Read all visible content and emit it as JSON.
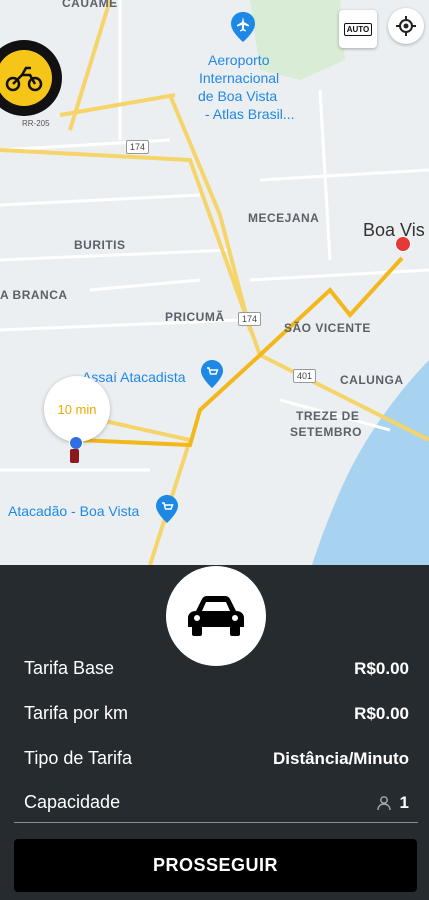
{
  "map": {
    "labels": {
      "cauame": "CAUAME",
      "airport_line1": "Aeroporto",
      "airport_line2": "Internacional",
      "airport_line3": "de Boa Vista",
      "airport_line4": "- Atlas Brasil...",
      "mecejana": "MECEJANA",
      "buritis": "BURITIS",
      "boa_vista": "Boa Vis",
      "branca": "A BRANCA",
      "pricuma": "PRICUMÃ",
      "sao_vicente": "SÃO VICENTE",
      "calunga": "CALUNGA",
      "assai": "Assaí Atacadista",
      "treze_line1": "TREZE DE",
      "treze_line2": "SETEMBRO",
      "atacadao": "Atacadão - Boa Vista",
      "rr205": "RR-205",
      "road174a": "174",
      "road174b": "174",
      "road401": "401"
    },
    "auto_button": "AUTO",
    "eta": "10 min",
    "icons": {
      "airport": "airplane-icon",
      "locate": "my-location-icon",
      "shop": "shopping-cart-icon"
    }
  },
  "panel": {
    "rows": [
      {
        "label": "Tarifa Base",
        "value": "R$0.00"
      },
      {
        "label": "Tarifa por km",
        "value": "R$0.00"
      },
      {
        "label": "Tipo de Tarifa",
        "value": "Distância/Minuto"
      },
      {
        "label": "Capacidade",
        "value": "1"
      }
    ],
    "proceed_button": "PROSSEGUIR"
  },
  "colors": {
    "panel_bg": "#262b30",
    "route": "#f2b81b",
    "eta_text": "#f2a900"
  }
}
